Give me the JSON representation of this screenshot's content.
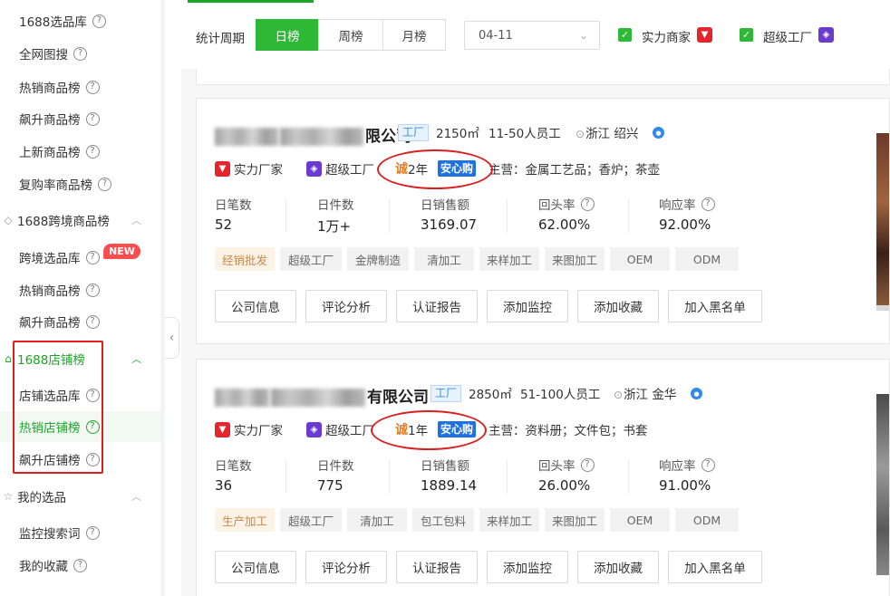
{
  "sidebar": {
    "items": [
      {
        "label": "1688选品库",
        "help": "?"
      },
      {
        "label": "全网图搜",
        "help": "?"
      },
      {
        "label": "热销商品榜",
        "help": "?"
      },
      {
        "label": "飙升商品榜",
        "help": "?"
      },
      {
        "label": "上新商品榜",
        "help": "?"
      },
      {
        "label": "复购率商品榜",
        "help": "?"
      }
    ],
    "group_crossborder": {
      "label": "1688跨境商品榜",
      "chevron": "︿"
    },
    "crossborder_items": [
      {
        "label": "跨境选品库",
        "help": "?",
        "badge": "NEW"
      },
      {
        "label": "热销商品榜",
        "help": "?"
      },
      {
        "label": "飙升商品榜",
        "help": "?"
      }
    ],
    "group_shop": {
      "label": "1688店铺榜",
      "chevron": "︿"
    },
    "shop_items": [
      {
        "label": "店铺选品库",
        "help": "?"
      },
      {
        "label": "热销店铺榜",
        "help": "?",
        "active": true
      },
      {
        "label": "飙升店铺榜",
        "help": "?"
      }
    ],
    "group_mine": {
      "label": "我的选品",
      "chevron": "︿"
    },
    "mine_items": [
      {
        "label": "监控搜索词",
        "help": "?"
      },
      {
        "label": "我的收藏",
        "help": "?"
      }
    ],
    "collapse_icon": "‹"
  },
  "toolbar": {
    "period_label": "统计周期",
    "periods": [
      "日榜",
      "周榜",
      "月榜"
    ],
    "date_value": "04-11",
    "filters": [
      {
        "label": "实力商家",
        "checked": true
      },
      {
        "label": "超级工厂",
        "checked": true
      }
    ]
  },
  "cards": [
    {
      "title_suffix": "限公司",
      "factory_tag": "工厂",
      "area": "2150㎡",
      "staff": "11-50人员工",
      "location": "浙江 绍兴",
      "badge_power": "实力厂家",
      "badge_super": "超级工厂",
      "cheng": "诚",
      "years": "2年",
      "anxin": "安心购",
      "main_business": "主营：金属工艺品；香炉；茶壶",
      "stats": [
        {
          "label": "日笔数",
          "value": "52",
          "help": false
        },
        {
          "label": "日件数",
          "value": "1万+",
          "help": false
        },
        {
          "label": "日销售额",
          "value": "3169.07",
          "help": false
        },
        {
          "label": "回头率",
          "value": "62.00%",
          "help": true
        },
        {
          "label": "响应率",
          "value": "92.00%",
          "help": true
        }
      ],
      "tags": [
        "经销批发",
        "超级工厂",
        "金牌制造",
        "清加工",
        "来样加工",
        "来图加工",
        "OEM",
        "ODM"
      ],
      "buttons": [
        "公司信息",
        "评论分析",
        "认证报告",
        "添加监控",
        "添加收藏",
        "加入黑名单"
      ]
    },
    {
      "title_suffix": "有限公司",
      "factory_tag": "工厂",
      "area": "2850㎡",
      "staff": "51-100人员工",
      "location": "浙江 金华",
      "badge_power": "实力厂家",
      "badge_super": "超级工厂",
      "cheng": "诚",
      "years": "1年",
      "anxin": "安心购",
      "main_business": "主营：资料册；文件包；书套",
      "stats": [
        {
          "label": "日笔数",
          "value": "36",
          "help": false
        },
        {
          "label": "日件数",
          "value": "775",
          "help": false
        },
        {
          "label": "日销售额",
          "value": "1889.14",
          "help": false
        },
        {
          "label": "回头率",
          "value": "26.00%",
          "help": true
        },
        {
          "label": "响应率",
          "value": "91.00%",
          "help": true
        }
      ],
      "tags": [
        "生产加工",
        "超级工厂",
        "清加工",
        "包工包料",
        "来样加工",
        "来图加工",
        "OEM",
        "ODM"
      ],
      "buttons": [
        "公司信息",
        "评论分析",
        "认证报告",
        "添加监控",
        "添加收藏",
        "加入黑名单"
      ]
    }
  ],
  "colors": {
    "accent": "#2fb835",
    "active_text": "#1aa727",
    "annotation": "#e21d1d"
  }
}
